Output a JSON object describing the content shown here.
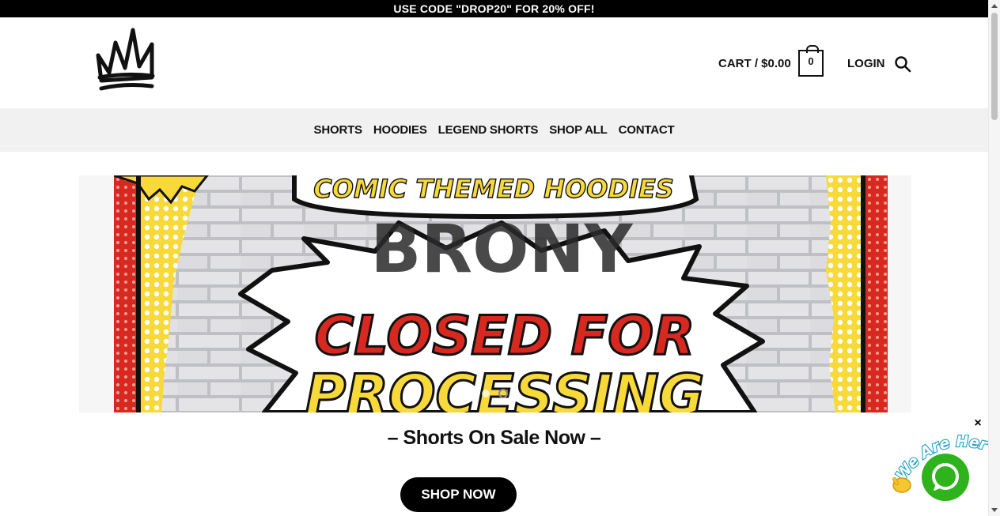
{
  "promo": {
    "text": "USE CODE \"DROP20\" FOR 20% OFF!"
  },
  "header": {
    "cart_label": "CART / $0.00",
    "cart_count": "0",
    "login_label": "LOGIN"
  },
  "nav": {
    "items": [
      {
        "label": "SHORTS"
      },
      {
        "label": "HOODIES"
      },
      {
        "label": "LEGEND SHORTS"
      },
      {
        "label": "SHOP ALL"
      },
      {
        "label": "CONTACT"
      }
    ]
  },
  "banner": {
    "top_text": "COMIC THEMED HOODIES",
    "brand_text": "BRONY",
    "line1": "CLOSED FOR",
    "line2": "PROCESSING",
    "colors": {
      "red": "#d7291f",
      "yellow": "#f7d93a",
      "black": "#111111",
      "brick": "#d9d9db"
    }
  },
  "main": {
    "headline": "– Shorts On Sale Now –",
    "cta_label": "SHOP NOW"
  },
  "chat": {
    "tagline": "We Are Here!",
    "close_label": "×",
    "accent": "#2fb31c"
  }
}
